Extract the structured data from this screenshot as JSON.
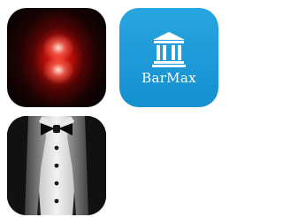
{
  "apps": [
    {
      "icon": "red-glow-icon"
    },
    {
      "icon": "bank-building-icon",
      "name": "BarMax"
    },
    {
      "icon": "tuxedo-icon"
    }
  ],
  "colors": {
    "background": "#ffffff",
    "barmax_blue": "#1c98d6",
    "glow_red": "#f01e14",
    "tuxedo_black": "#141414"
  }
}
